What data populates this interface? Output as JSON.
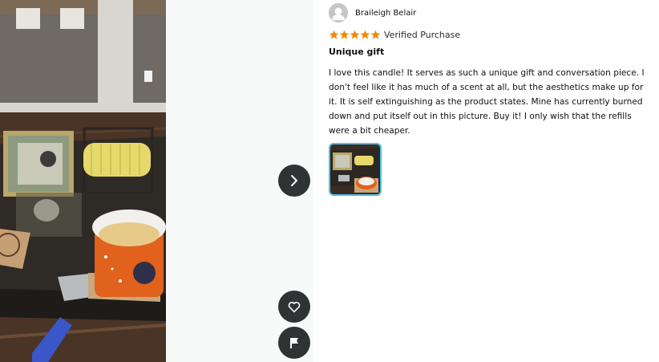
{
  "review": {
    "reviewer_name": "Braileigh Belair",
    "rating": 5,
    "rating_max": 5,
    "verified_label": "Verified Purchase",
    "title": "Unique gift",
    "body": "I love this candle! It serves as such a unique gift and conversation piece. I don't feel like it has much of a scent at all, but the aesthetics make up for it. It is self extinguishing as the product states. Mine has currently burned down and put itself out in this picture. Buy it! I only wish that the refills were a bit cheaper."
  },
  "controls": {
    "next_icon": "chevron-right-icon",
    "like_icon": "heart-icon",
    "report_icon": "flag-icon"
  },
  "colors": {
    "star": "#f08804",
    "thumb_border": "#4fbfe8",
    "button_bg": "#2f3333"
  }
}
